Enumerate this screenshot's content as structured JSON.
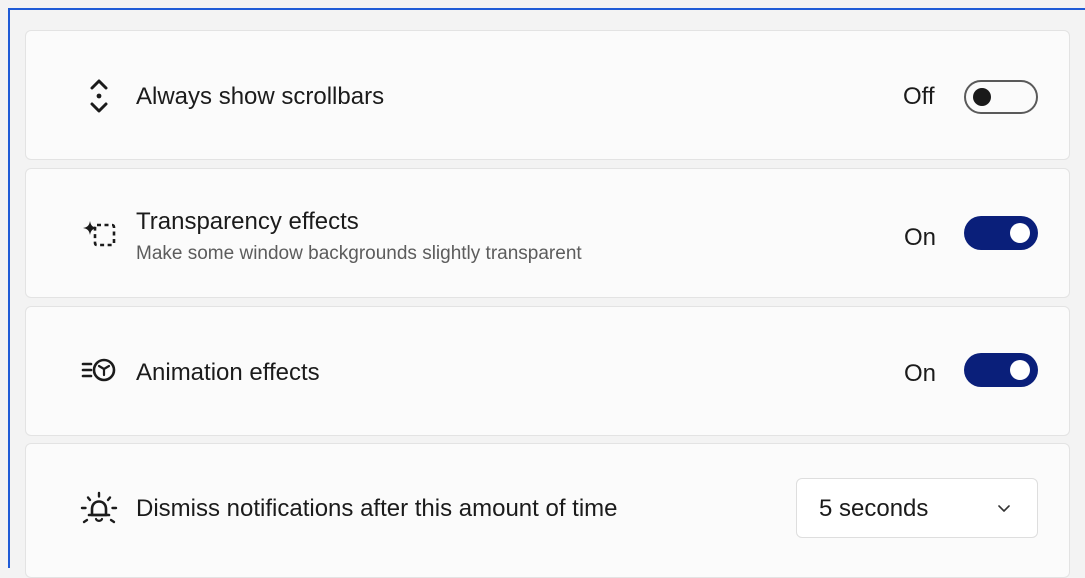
{
  "settings": [
    {
      "icon": "scrollbar-icon",
      "title": "Always show scrollbars",
      "state": "Off",
      "enabled": false
    },
    {
      "icon": "transparency-icon",
      "title": "Transparency effects",
      "subtitle": "Make some window backgrounds slightly transparent",
      "state": "On",
      "enabled": true
    },
    {
      "icon": "animation-icon",
      "title": "Animation effects",
      "state": "On",
      "enabled": true
    },
    {
      "icon": "notification-bell-icon",
      "title": "Dismiss notifications after this amount of time",
      "dropdown_value": "5 seconds"
    }
  ],
  "colors": {
    "accent": "#0a1f7a",
    "frame": "#1f5bd6",
    "card": "#fbfbfb",
    "background": "#f3f3f3"
  }
}
